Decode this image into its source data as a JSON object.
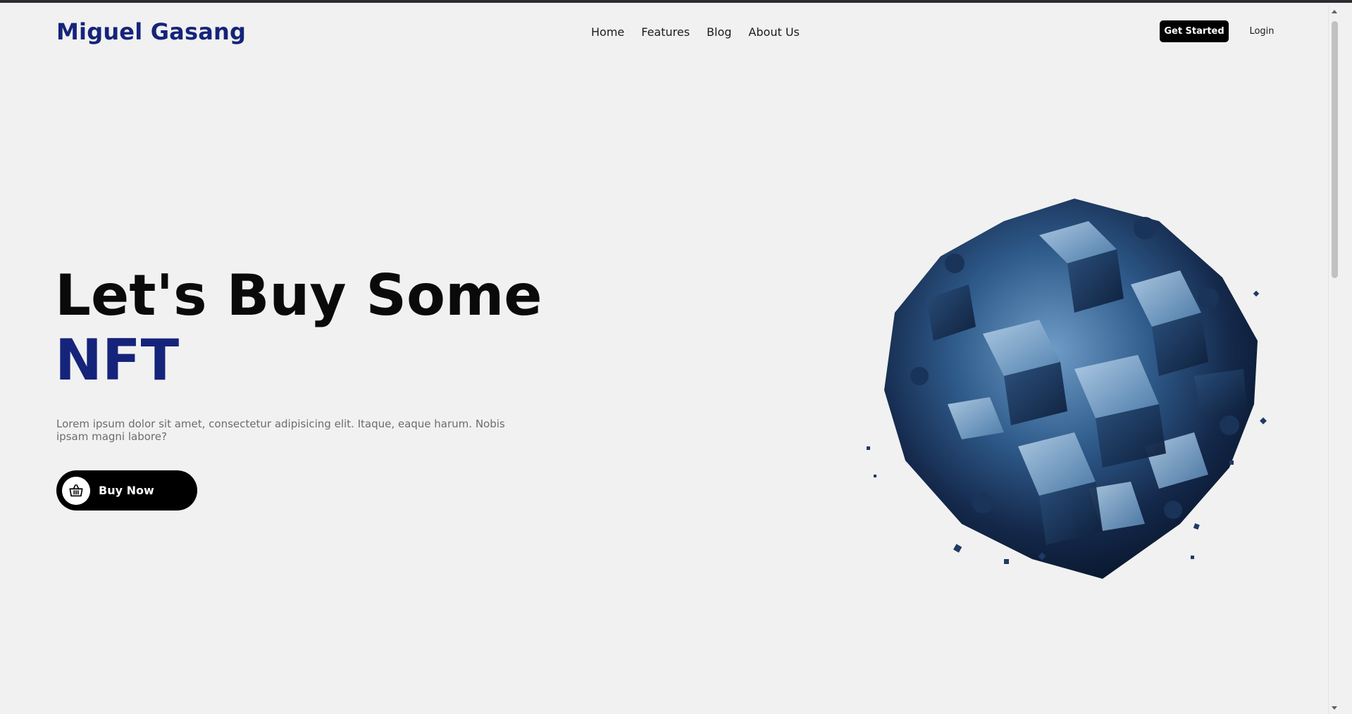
{
  "header": {
    "logo": "Miguel Gasang",
    "nav": [
      "Home",
      "Features",
      "Blog",
      "About Us"
    ],
    "get_started": "Get Started",
    "login": "Login"
  },
  "hero": {
    "title_line1": "Let's Buy Some",
    "title_line2": "NFT",
    "description": "Lorem ipsum dolor sit amet, consectetur adipisicing elit. Itaque, eaque harum. Nobis ipsam magni labore?",
    "buy_button": "Buy Now",
    "buy_icon": "basket-icon"
  },
  "colors": {
    "accent": "#15247a",
    "background": "#f1f1f1",
    "button": "#000000"
  }
}
